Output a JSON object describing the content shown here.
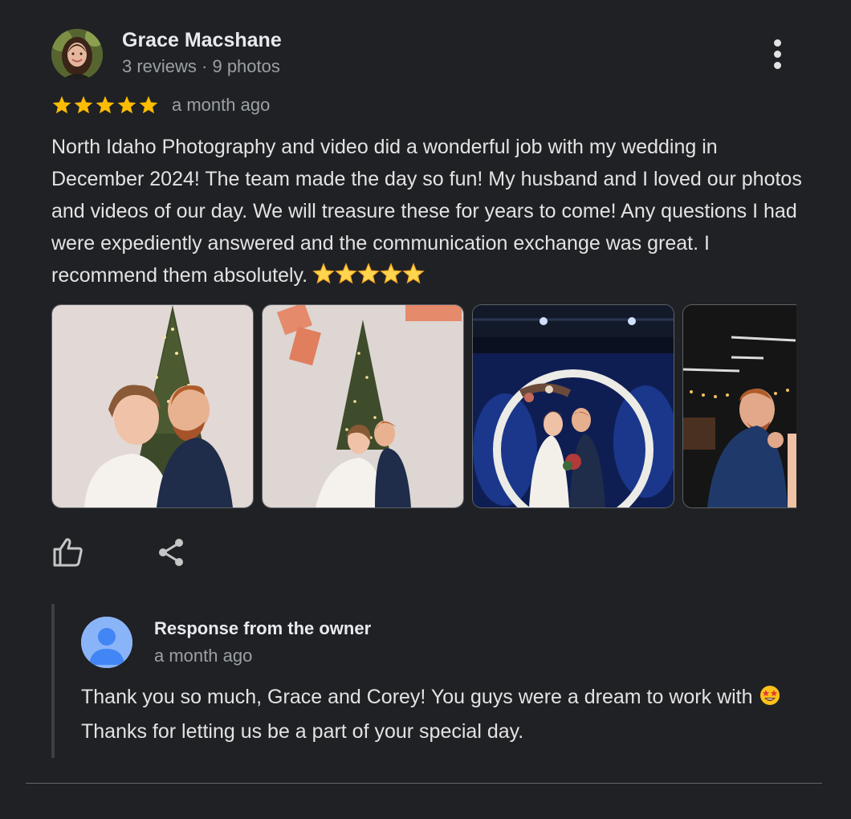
{
  "reviewer": {
    "name": "Grace Macshane",
    "meta": "3 reviews · 9 photos"
  },
  "review": {
    "rating": 5,
    "date": "a month ago",
    "text": "North Idaho Photography and video did a wonderful job with my wedding in December 2024! The team made the day so fun! My husband and I loved our photos and videos of our day. We will treasure these for years to come! Any questions I had were expediently answered and the communication exchange was great. I recommend them absolutely.",
    "trailing_emoji": "⭐⭐⭐⭐⭐"
  },
  "photos": [
    {
      "name": "wedding-photo-1",
      "subject": "couple-embrace-christmas-tree"
    },
    {
      "name": "wedding-photo-2",
      "subject": "couple-laughing-christmas-tree"
    },
    {
      "name": "wedding-photo-3",
      "subject": "couple-kiss-floral-arch"
    },
    {
      "name": "wedding-photo-4",
      "subject": "groom-emotional"
    }
  ],
  "actions": {
    "like_icon": "thumbs-up-icon",
    "share_icon": "share-icon",
    "more_icon": "more-vert-icon"
  },
  "owner_response": {
    "title": "Response from the owner",
    "date": "a month ago",
    "text_before_emoji": "Thank you so much, Grace and Corey! You guys were a dream to work with",
    "emoji": "🤩",
    "text_after_emoji": "Thanks for letting us be a part of your special day."
  },
  "colors": {
    "background": "#202124",
    "star": "#fbbc04",
    "secondary_text": "#9aa0a6",
    "owner_avatar": "#8ab4f8"
  }
}
